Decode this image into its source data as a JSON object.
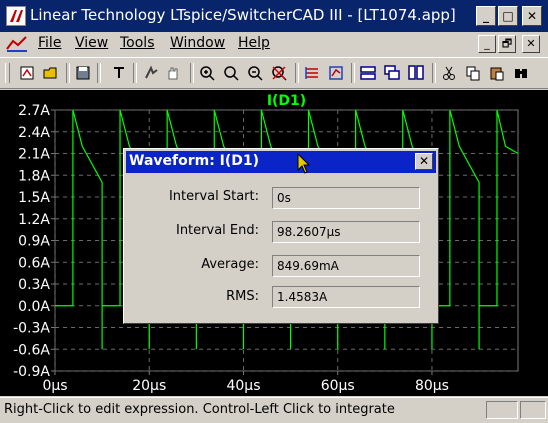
{
  "window": {
    "title": "Linear Technology LTspice/SwitcherCAD III - [LT1074.app]",
    "min": "_",
    "max": "□",
    "close": "✕"
  },
  "menu": {
    "items": [
      "File",
      "View",
      "Tools",
      "Window",
      "Help"
    ],
    "child_min": "_",
    "child_restore": "🗗",
    "child_close": "✕"
  },
  "toolbar": {
    "icons": [
      "new-schematic-icon",
      "open-icon",
      "save-icon",
      "probe-icon",
      "run-icon",
      "pan-hand-icon",
      "zoom-in-icon",
      "zoom-area-icon",
      "zoom-out-icon",
      "zoom-cancel-icon",
      "autorange-icon",
      "zoom-full-icon",
      "tile-horizontal-icon",
      "cascade-icon",
      "tile-vertical-icon",
      "cut-icon",
      "copy-icon",
      "paste-icon",
      "find-icon"
    ]
  },
  "plot": {
    "trace_label": "I(D1)",
    "trace_color": "#00ff00",
    "grid_color": "#6a6a6a",
    "axis_color": "#7a7a7a",
    "background": "#000000"
  },
  "chart_data": {
    "type": "line",
    "title": "I(D1)",
    "xlabel": "",
    "ylabel": "",
    "x_ticks": [
      "0µs",
      "20µs",
      "40µs",
      "60µs",
      "80µs"
    ],
    "y_ticks": [
      "2.7A",
      "2.4A",
      "2.1A",
      "1.8A",
      "1.5A",
      "1.2A",
      "0.9A",
      "0.6A",
      "0.3A",
      "0.0A",
      "-0.3A",
      "-0.6A",
      "-0.9A"
    ],
    "xlim": [
      0,
      98.26
    ],
    "ylim": [
      -0.9,
      2.7
    ],
    "grid": true,
    "series": [
      {
        "name": "I(D1)",
        "period_us": 10,
        "on_start_us": 3.8,
        "off_start_us": 0,
        "peak_A": 2.7,
        "shoulder_A": 2.2,
        "end_A": 1.7,
        "undershoot_A": -0.6,
        "low_A": 0.0
      }
    ]
  },
  "dialog": {
    "title": "Waveform: I(D1)",
    "close": "✕",
    "fields": [
      {
        "label": "Interval Start:",
        "value": "0s"
      },
      {
        "label": "Interval End:",
        "value": "98.2607µs"
      },
      {
        "label": "Average:",
        "value": "849.69mA"
      },
      {
        "label": "RMS:",
        "value": "1.4583A"
      }
    ]
  },
  "status": {
    "text": "Right-Click to edit expression. Control-Left Click to integrate"
  }
}
